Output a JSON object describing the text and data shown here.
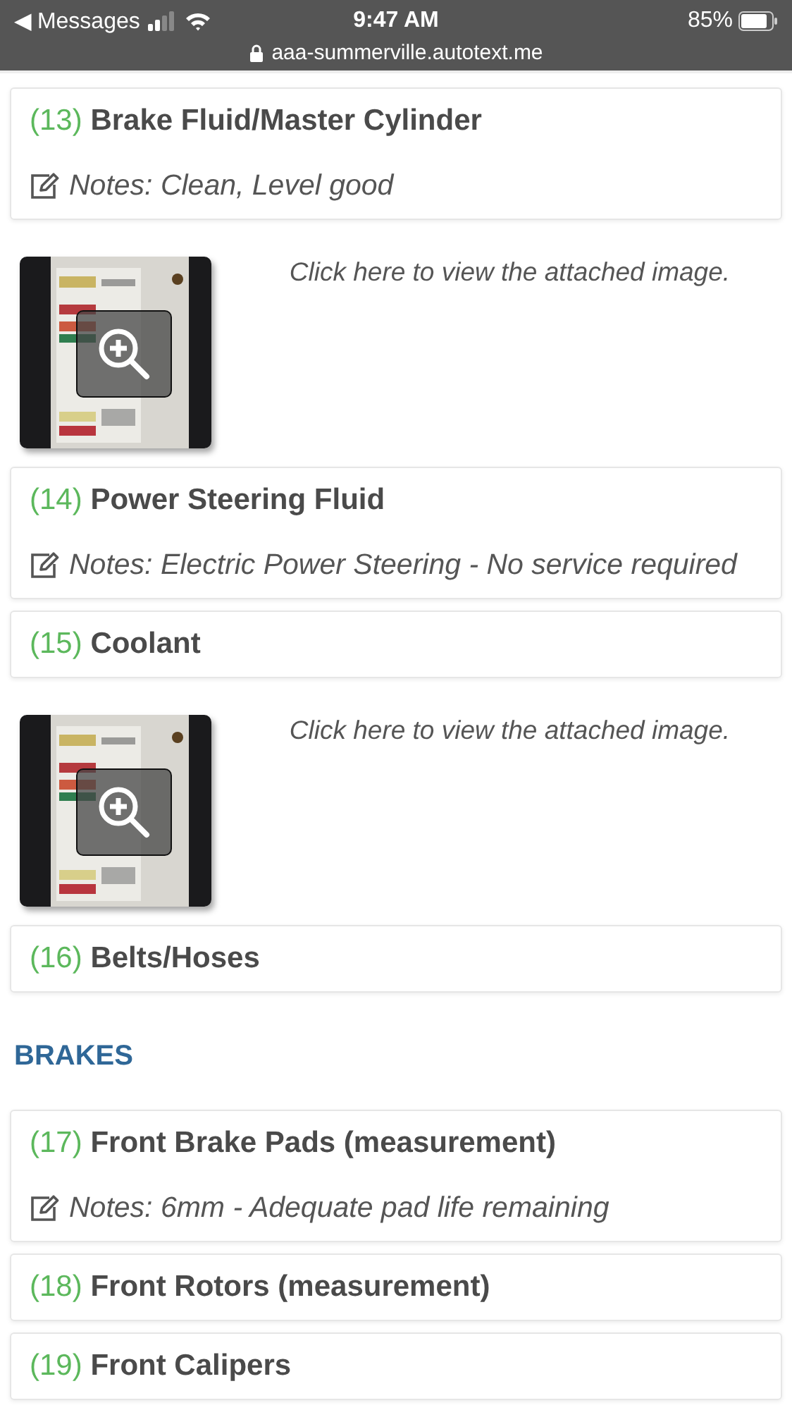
{
  "status_bar": {
    "back_label": "◀ Messages",
    "time": "9:47 AM",
    "battery": "85%",
    "url": "aaa-summerville.autotext.me"
  },
  "items": [
    {
      "kind": "item",
      "number": "(13)",
      "title": "Brake Fluid/Master Cylinder",
      "notes": "Notes: Clean, Level good"
    },
    {
      "caption": "Click here to view the attached image."
    },
    {
      "kind": "item",
      "number": "(14)",
      "title": "Power Steering Fluid",
      "notes": "Notes: Electric Power Steering - No service required"
    },
    {
      "kind": "item",
      "number": "(15)",
      "title": "Coolant"
    },
    {
      "caption": "Click here to view the attached image."
    },
    {
      "kind": "item",
      "number": "(16)",
      "title": "Belts/Hoses"
    },
    {
      "kind": "section",
      "title": "BRAKES"
    },
    {
      "kind": "item",
      "number": "(17)",
      "title": "Front Brake Pads (measurement)",
      "notes": "Notes: 6mm - Adequate pad life remaining"
    },
    {
      "kind": "item",
      "number": "(18)",
      "title": "Front Rotors (measurement)"
    },
    {
      "kind": "item",
      "number": "(19)",
      "title": "Front Calipers"
    }
  ]
}
